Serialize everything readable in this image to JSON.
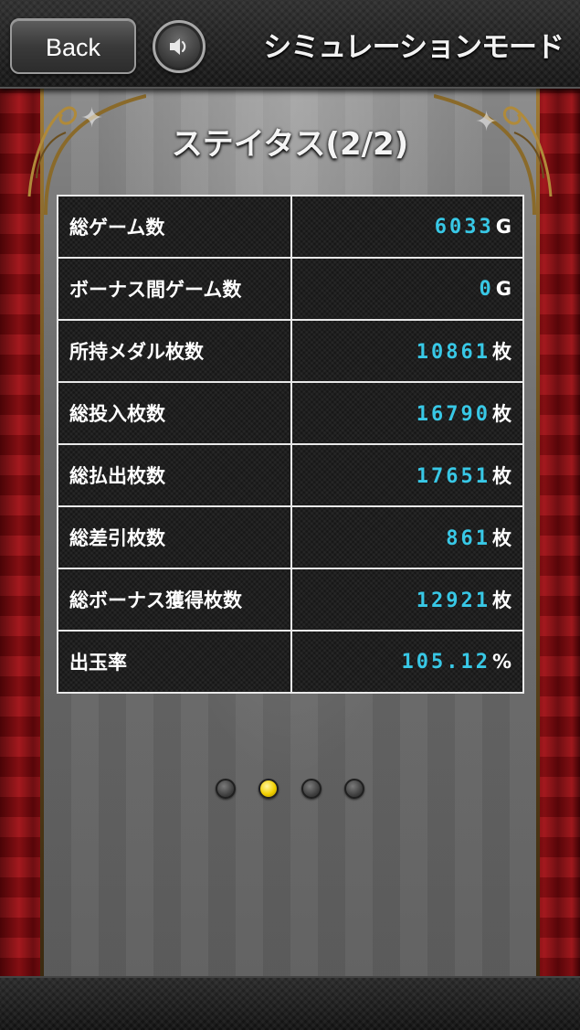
{
  "header": {
    "back_label": "Back",
    "title": "シミュレーションモード"
  },
  "page": {
    "title": "ステイタス(2/2)"
  },
  "stats": [
    {
      "label": "総ゲーム数",
      "value": "6033",
      "unit": "G"
    },
    {
      "label": "ボーナス間ゲーム数",
      "value": "0",
      "unit": "G"
    },
    {
      "label": "所持メダル枚数",
      "value": "10861",
      "unit": "枚"
    },
    {
      "label": "総投入枚数",
      "value": "16790",
      "unit": "枚"
    },
    {
      "label": "総払出枚数",
      "value": "17651",
      "unit": "枚"
    },
    {
      "label": "総差引枚数",
      "value": "861",
      "unit": "枚"
    },
    {
      "label": "総ボーナス獲得枚数",
      "value": "12921",
      "unit": "枚"
    },
    {
      "label": "出玉率",
      "value": "105.12",
      "unit": "%"
    }
  ],
  "pagination": {
    "total": 4,
    "current": 2
  },
  "colors": {
    "value_accent": "#38c8e6",
    "active_dot": "#f2d000",
    "curtain": "#a11217"
  },
  "icons": {
    "sound": "speaker-icon"
  }
}
